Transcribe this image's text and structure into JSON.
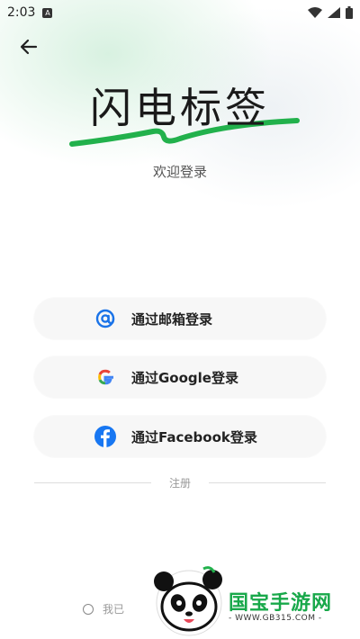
{
  "status_bar": {
    "time": "2:03"
  },
  "header": {
    "brand_title": "闪电标签",
    "subtitle": "欢迎登录"
  },
  "login_options": [
    {
      "label": "通过邮箱登录",
      "icon": "email-at-icon"
    },
    {
      "label": "通过Google登录",
      "icon": "google-icon"
    },
    {
      "label": "通过Facebook登录",
      "icon": "facebook-icon"
    }
  ],
  "register_label": "注册",
  "agreement_text": "我已",
  "watermark": {
    "text": "国宝手游网",
    "url": "- WWW.GB315.COM -"
  },
  "colors": {
    "accent_green": "#22b14c",
    "facebook_blue": "#1877f2",
    "email_blue": "#1a73e8"
  }
}
